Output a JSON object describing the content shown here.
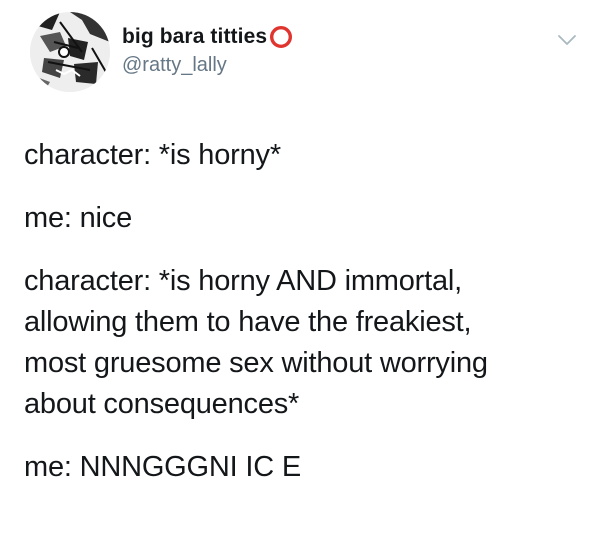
{
  "author": {
    "display_name": "big bara titties",
    "handle": "@ratty_lally"
  },
  "icons": {
    "avatar": "avatar-manga-illustration",
    "name_emoji": "heavy-large-circle-icon",
    "menu": "chevron-down-icon"
  },
  "colors": {
    "text": "#14171a",
    "handle": "#657786",
    "emoji_red": "#e0342f",
    "chevron": "#aab8c2"
  },
  "tweet": {
    "lines": [
      "character: *is horny*",
      "me: nice",
      "character: *is horny AND immortal,",
      "allowing them to have the freakiest,",
      "most gruesome sex without worrying",
      "about consequences*",
      "me: NNNGGGNI IC E"
    ]
  }
}
